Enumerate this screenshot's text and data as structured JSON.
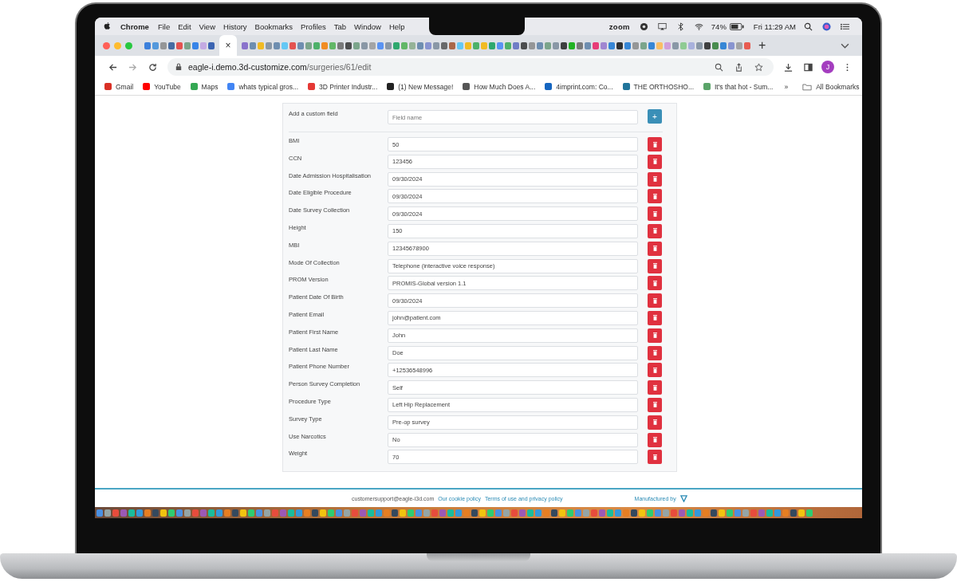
{
  "menubar": {
    "app": "Chrome",
    "menus": [
      "File",
      "Edit",
      "View",
      "History",
      "Bookmarks",
      "Profiles",
      "Tab",
      "Window",
      "Help"
    ],
    "zoom": "zoom",
    "battery": "74%",
    "clock": "Fri 11:29 AM"
  },
  "browser": {
    "url_host": "eagle-i.demo.3d-customize.com",
    "url_path": "/surgeries/61/edit",
    "profile": "J",
    "close": "×",
    "new_tab": "+",
    "bookmarks": [
      {
        "label": "Gmail",
        "color": "#d93025"
      },
      {
        "label": "YouTube",
        "color": "#ff0000"
      },
      {
        "label": "Maps",
        "color": "#34a853"
      },
      {
        "label": "whats typical gros...",
        "color": "#4285f4"
      },
      {
        "label": "3D Printer Industr...",
        "color": "#e53935"
      },
      {
        "label": "(1) New Message!",
        "color": "#222222"
      },
      {
        "label": "How Much Does A...",
        "color": "#555555"
      },
      {
        "label": "4imprint.com: Co...",
        "color": "#1565c0"
      },
      {
        "label": "THE ORTHOSHO...",
        "color": "#21759b"
      },
      {
        "label": "It's that hot - Sum...",
        "color": "#5aa469"
      }
    ],
    "more": "»",
    "all_bookmarks": "All Bookmarks"
  },
  "form": {
    "add_label": "Add a custom field",
    "placeholder": "Field name",
    "add_button": "+",
    "fields": [
      {
        "label": "BMI",
        "value": "50"
      },
      {
        "label": "CCN",
        "value": "123456"
      },
      {
        "label": "Date Admission Hospitalisation",
        "value": "09/30/2024"
      },
      {
        "label": "Date Eligible Procedure",
        "value": "09/30/2024"
      },
      {
        "label": "Date Survey Collection",
        "value": "09/30/2024"
      },
      {
        "label": "Height",
        "value": "150"
      },
      {
        "label": "MBI",
        "value": "12345678900"
      },
      {
        "label": "Mode Of Collection",
        "value": "Telephone (interactive voice response)"
      },
      {
        "label": "PROM Version",
        "value": "PROMIS-Global version 1.1"
      },
      {
        "label": "Patient Date Of Birth",
        "value": "09/30/2024"
      },
      {
        "label": "Patient Email",
        "value": "john@patient.com"
      },
      {
        "label": "Patient First Name",
        "value": "John"
      },
      {
        "label": "Patient Last Name",
        "value": "Doe"
      },
      {
        "label": "Patient Phone Number",
        "value": "+12536548996"
      },
      {
        "label": "Person Survey Completion",
        "value": "Self"
      },
      {
        "label": "Procedure Type",
        "value": "Left Hip Replacement"
      },
      {
        "label": "Survey Type",
        "value": "Pre-op survey"
      },
      {
        "label": "Use Narcotics",
        "value": "No"
      },
      {
        "label": "Weight",
        "value": "70"
      }
    ]
  },
  "footer": {
    "email": "customersupport@eagle-i3d.com",
    "links": [
      "Our cookie policy",
      "Terms of use and privacy policy"
    ],
    "manufactured": "Manufactured by"
  }
}
